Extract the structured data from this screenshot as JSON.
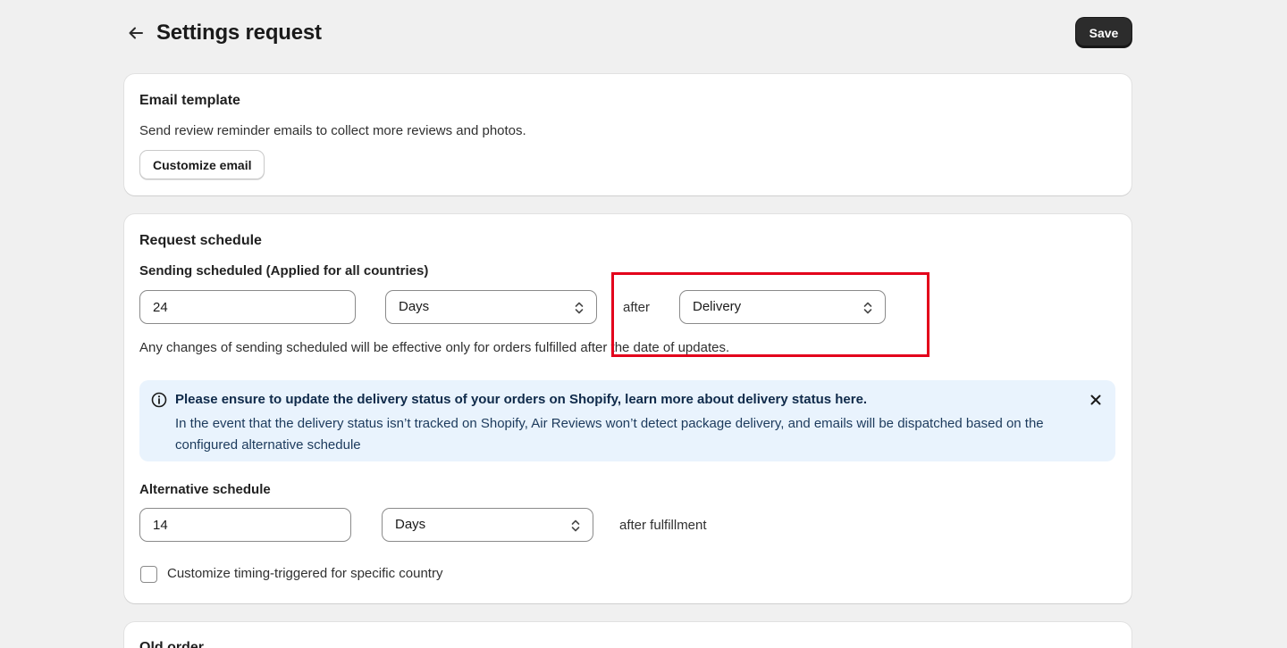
{
  "header": {
    "title": "Settings request",
    "save_label": "Save"
  },
  "email_template": {
    "title": "Email template",
    "description": "Send review reminder emails to collect more reviews and photos.",
    "customize_label": "Customize email"
  },
  "request_schedule": {
    "title": "Request schedule",
    "sending_label": "Sending scheduled (Applied for all countries)",
    "sending_value": "24",
    "sending_unit": "Days",
    "after_text": "after",
    "trigger_event": "Delivery",
    "note": "Any changes of sending scheduled will be effective only for orders fulfilled after the date of updates.",
    "banner": {
      "title": "Please ensure to update the delivery status of your orders on Shopify, learn more about delivery status here.",
      "body": "In the event that the delivery status isn’t tracked on Shopify, Air Reviews won’t detect package delivery, and emails will be dispatched based on the configured alternative schedule"
    },
    "alternative_label": "Alternative schedule",
    "alternative_value": "14",
    "alternative_unit": "Days",
    "after_fulfillment_text": "after fulfillment",
    "country_checkbox_label": "Customize timing-triggered for specific country",
    "country_checkbox_checked": false
  },
  "old_order": {
    "title": "Old order"
  },
  "colors": {
    "highlight": "#e3001b",
    "banner_bg": "#e9f3fd",
    "primary_button": "#2c2c2c"
  }
}
